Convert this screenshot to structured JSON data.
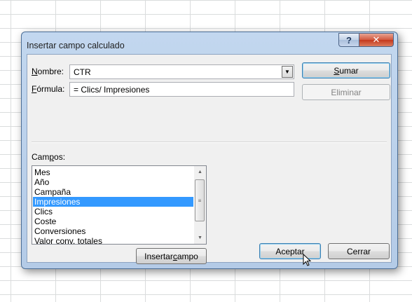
{
  "dialog": {
    "title": "Insertar campo calculado",
    "help_glyph": "?",
    "close_glyph": "✕"
  },
  "nombre": {
    "label_underlined": "N",
    "label_rest": "ombre:",
    "value": "CTR",
    "arrow_glyph": "▼"
  },
  "formula": {
    "label_underlined": "F",
    "label_rest": "órmula:",
    "value": "= Clics/ Impresiones"
  },
  "buttons": {
    "sumar_underlined": "S",
    "sumar_rest": "umar",
    "eliminar": "Eliminar",
    "insertar_prefix": "Insertar ",
    "insertar_underlined": "c",
    "insertar_rest": "ampo",
    "aceptar": "Aceptar",
    "cerrar": "Cerrar"
  },
  "campos": {
    "label_prefix": "Cam",
    "label_underlined": "p",
    "label_rest": "os:",
    "items": [
      "Mes",
      "Año",
      "Campaña",
      "Impresiones",
      "Clics",
      "Coste",
      "Conversiones",
      "Valor conv. totales"
    ],
    "selected_index": 3,
    "scroll_up_glyph": "▲",
    "scroll_down_glyph": "▼",
    "thumb_glyph": "≡"
  }
}
